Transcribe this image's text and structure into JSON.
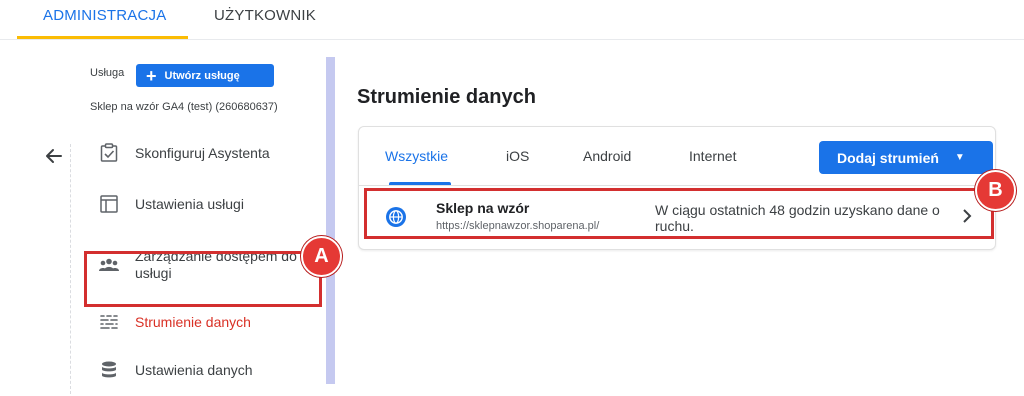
{
  "top_tabs": {
    "admin": "ADMINISTRACJA",
    "user": "UŻYTKOWNIK"
  },
  "sidebar": {
    "property_label": "Usługa",
    "create_button": "Utwórz usługę",
    "property_name": "Sklep na wzór GA4 (test) (260680637)",
    "items": [
      {
        "label": "Skonfiguruj Asystenta",
        "icon": "checklist-icon"
      },
      {
        "label": "Ustawienia usługi",
        "icon": "settings-window-icon"
      },
      {
        "label": "Zarządzanie dostępem do usługi",
        "icon": "people-icon"
      },
      {
        "label": "Strumienie danych",
        "icon": "data-streams-icon",
        "active": true
      },
      {
        "label": "Ustawienia danych",
        "icon": "database-icon"
      }
    ]
  },
  "main": {
    "title": "Strumienie danych",
    "tabs": [
      "Wszystkie",
      "iOS",
      "Android",
      "Internet"
    ],
    "active_tab": "Wszystkie",
    "add_button": "Dodaj strumień",
    "streams": [
      {
        "name": "Sklep na wzór",
        "url": "https://sklepnawzor.shoparena.pl/",
        "status": "W ciągu ostatnich 48 godzin uzyskano dane o ruchu."
      }
    ]
  },
  "annotations": {
    "a": "A",
    "b": "B"
  },
  "colors": {
    "accent": "#1a73e8",
    "active_nav": "#d93025",
    "highlight": "#d32f2f",
    "tab_underline_top": "#fbbc04"
  }
}
